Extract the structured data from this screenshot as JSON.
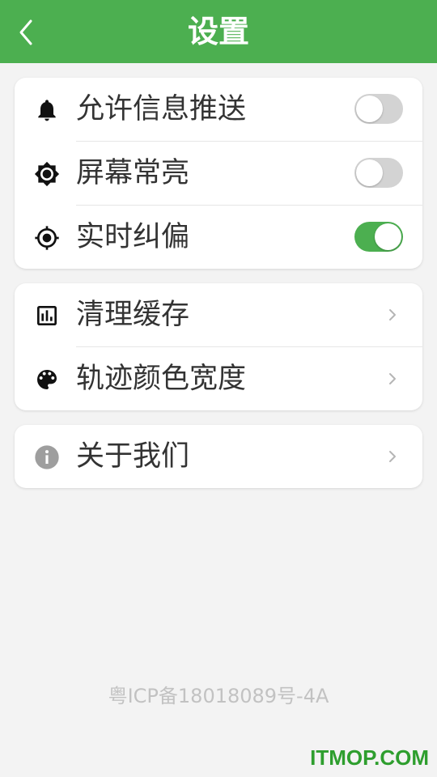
{
  "header": {
    "title": "设置",
    "back_icon": "chevron-left-icon",
    "bg_color": "#4caf50"
  },
  "group1": [
    {
      "label": "允许信息推送",
      "icon": "bell-icon",
      "toggle": false
    },
    {
      "label": "屏幕常亮",
      "icon": "brightness-icon",
      "toggle": false
    },
    {
      "label": "实时纠偏",
      "icon": "gps-target-icon",
      "toggle": true
    }
  ],
  "group2": [
    {
      "label": "清理缓存",
      "icon": "chart-box-icon"
    },
    {
      "label": "轨迹颜色宽度",
      "icon": "palette-icon"
    }
  ],
  "group3": [
    {
      "label": "关于我们",
      "icon": "info-icon"
    }
  ],
  "footer": {
    "icp": "粤ICP备18018089号-4A"
  },
  "watermark": "ITMOP.COM",
  "colors": {
    "accent": "#4caf50",
    "toggle_off": "#d3d3d3",
    "text": "#333333"
  }
}
